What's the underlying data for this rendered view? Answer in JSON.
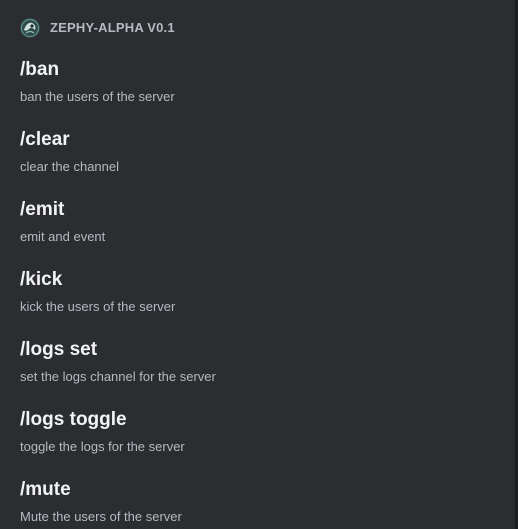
{
  "app": {
    "bot_name": "ZEPHY-ALPHA V0.1",
    "avatar_icon": "bot-avatar-icon"
  },
  "commands": [
    {
      "name": "/ban",
      "description": "ban the users of the server"
    },
    {
      "name": "/clear",
      "description": "clear the channel"
    },
    {
      "name": "/emit",
      "description": "emit and event"
    },
    {
      "name": "/kick",
      "description": "kick the users of the server"
    },
    {
      "name": "/logs set",
      "description": "set the logs channel for the server"
    },
    {
      "name": "/logs toggle",
      "description": "toggle the logs for the server"
    },
    {
      "name": "/mute",
      "description": "Mute the users of the server"
    }
  ],
  "colors": {
    "background": "#2b2d31",
    "command_name": "#f2f3f5",
    "muted_text": "#b5bac1"
  }
}
